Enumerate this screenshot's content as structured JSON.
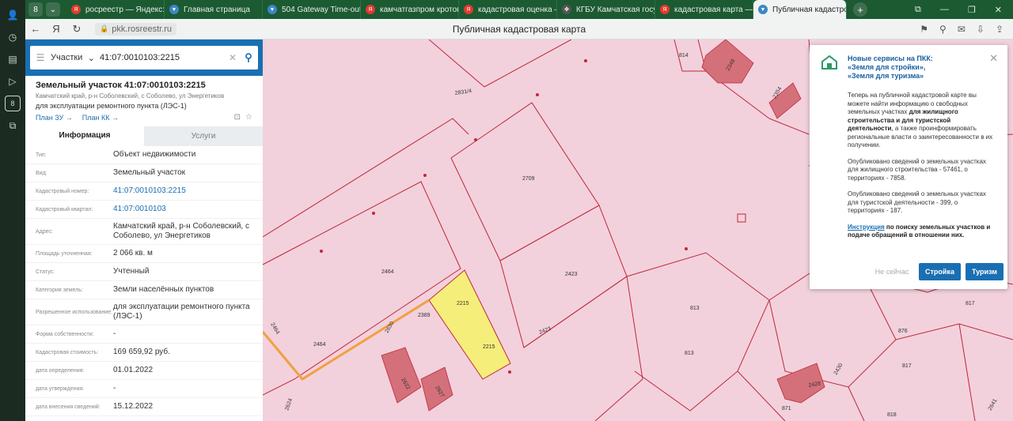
{
  "browser": {
    "tabs": [
      {
        "label": "росреестр — Яндекс: н",
        "color": "#e23a2e",
        "fav": "Я"
      },
      {
        "label": "Главная страница",
        "color": "#3b87c8",
        "fav": "▼"
      },
      {
        "label": "504 Gateway Time-out",
        "color": "#3b87c8",
        "fav": "▼"
      },
      {
        "label": "камчатгазпром кротов",
        "color": "#e23a2e",
        "fav": "Я"
      },
      {
        "label": "кадастровая оценка —",
        "color": "#e23a2e",
        "fav": "Я"
      },
      {
        "label": "КГБУ Камчатская госуд",
        "color": "#555",
        "fav": "✤"
      },
      {
        "label": "кадастровая карта — Я",
        "color": "#e23a2e",
        "fav": "Я"
      }
    ],
    "active_tab": "Публичная кадастрова",
    "url": "pkk.rosreestr.ru",
    "page_title": "Публичная кадастровая карта"
  },
  "search": {
    "type": "Участки",
    "value": "41:07:0010103:2215"
  },
  "object": {
    "title": "Земельный участок 41:07:0010103:2215",
    "address_short": "Камчатский край, р-н Соболевский, с Соболево, ул Энергетиков",
    "use": "для эксплуатации ремонтного пункта (ЛЭС-1)",
    "plan_zu": "План ЗУ →",
    "plan_kk": "План КК →"
  },
  "tabs": {
    "info": "Информация",
    "services": "Услуги"
  },
  "props": [
    {
      "k": "Тип:",
      "v": "Объект недвижимости",
      "link": false
    },
    {
      "k": "Вид:",
      "v": "Земельный участок",
      "link": false
    },
    {
      "k": "Кадастровый номер:",
      "v": "41:07:0010103:2215",
      "link": true
    },
    {
      "k": "Кадастровый квартал:",
      "v": "41:07:0010103",
      "link": true
    },
    {
      "k": "Адрес:",
      "v": "Камчатский край, р-н Соболевский, с Соболево, ул Энергетиков",
      "link": false
    },
    {
      "k": "Площадь уточненная:",
      "v": "2 066 кв. м",
      "link": false
    },
    {
      "k": "Статус:",
      "v": "Учтенный",
      "link": false
    },
    {
      "k": "Категория земель:",
      "v": "Земли населённых пунктов",
      "link": false
    },
    {
      "k": "Разрешенное использование:",
      "v": "для эксплуатации ремонтного пункта (ЛЭС-1)",
      "link": false
    },
    {
      "k": "Форма собственности:",
      "v": "-",
      "link": false
    },
    {
      "k": "Кадастровая стоимость:",
      "v": "169 659,92 руб.",
      "link": false
    },
    {
      "k": "дата определения:",
      "v": "01.01.2022",
      "link": false
    },
    {
      "k": "дата утверждения:",
      "v": "-",
      "link": false
    },
    {
      "k": "дата внесения сведений:",
      "v": "15.12.2022",
      "link": false
    }
  ],
  "map_labels": [
    "2831/4",
    "814",
    "2349",
    "2354",
    "2709",
    "2464",
    "2423",
    "2215",
    "2215",
    "2389",
    "2464",
    "2423",
    "813",
    "813",
    "817",
    "876",
    "817",
    "2464",
    "2630",
    "2622",
    "2627",
    "2428",
    "2430",
    "871",
    "818",
    "2641",
    "2624"
  ],
  "popup": {
    "title1": "Новые сервисы на ПКК:",
    "title2": "«Земля для стройки»,",
    "title3": "«Земля для туризма»",
    "p1a": "Теперь на публичной кадастровой карте вы можете найти информацию о свободных земельных участках",
    "p1b": "для жилищного строительства",
    "p1c": "и для туристской деятельности",
    "p1d": ", а также проинформировать региональные власти о заинтересованности в их получении.",
    "p2": "Опубликовано сведений о земельных участках для жилищного строительства - 57461, о территориях - 7858.",
    "p3": "Опубликовано сведений о земельных участках для туристской деятельности - 399, о территориях - 187.",
    "p4a": "Инструкция",
    "p4b": "по поиску земельных участков и подаче обращений в отношении них.",
    "later": "Не сейчас",
    "btn1": "Стройка",
    "btn2": "Туризм"
  }
}
